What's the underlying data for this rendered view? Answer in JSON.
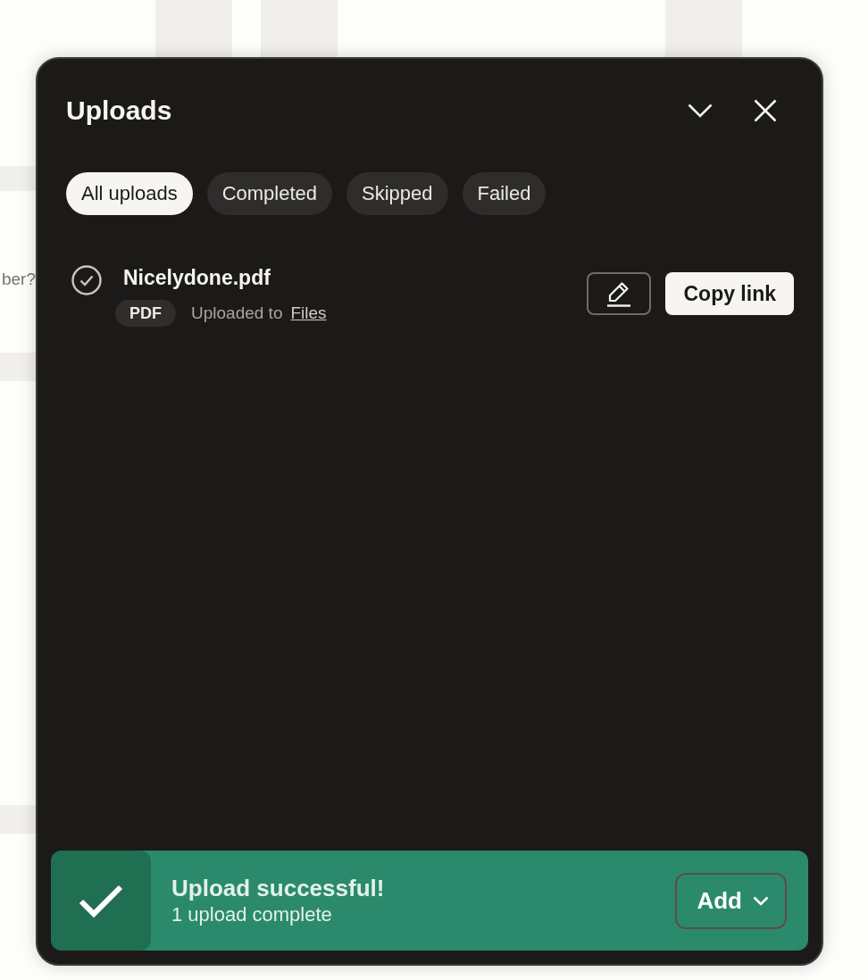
{
  "background": {
    "text": "ber?"
  },
  "panel": {
    "title": "Uploads"
  },
  "filters": [
    {
      "label": "All uploads",
      "selected": true
    },
    {
      "label": "Completed",
      "selected": false
    },
    {
      "label": "Skipped",
      "selected": false
    },
    {
      "label": "Failed",
      "selected": false
    }
  ],
  "uploads": [
    {
      "name": "Nicelydone.pdf",
      "type": "PDF",
      "status_text": "Uploaded to",
      "location": "Files",
      "action": "Copy link"
    }
  ],
  "toast": {
    "title": "Upload successful!",
    "subtitle": "1 upload complete",
    "button": "Add"
  }
}
